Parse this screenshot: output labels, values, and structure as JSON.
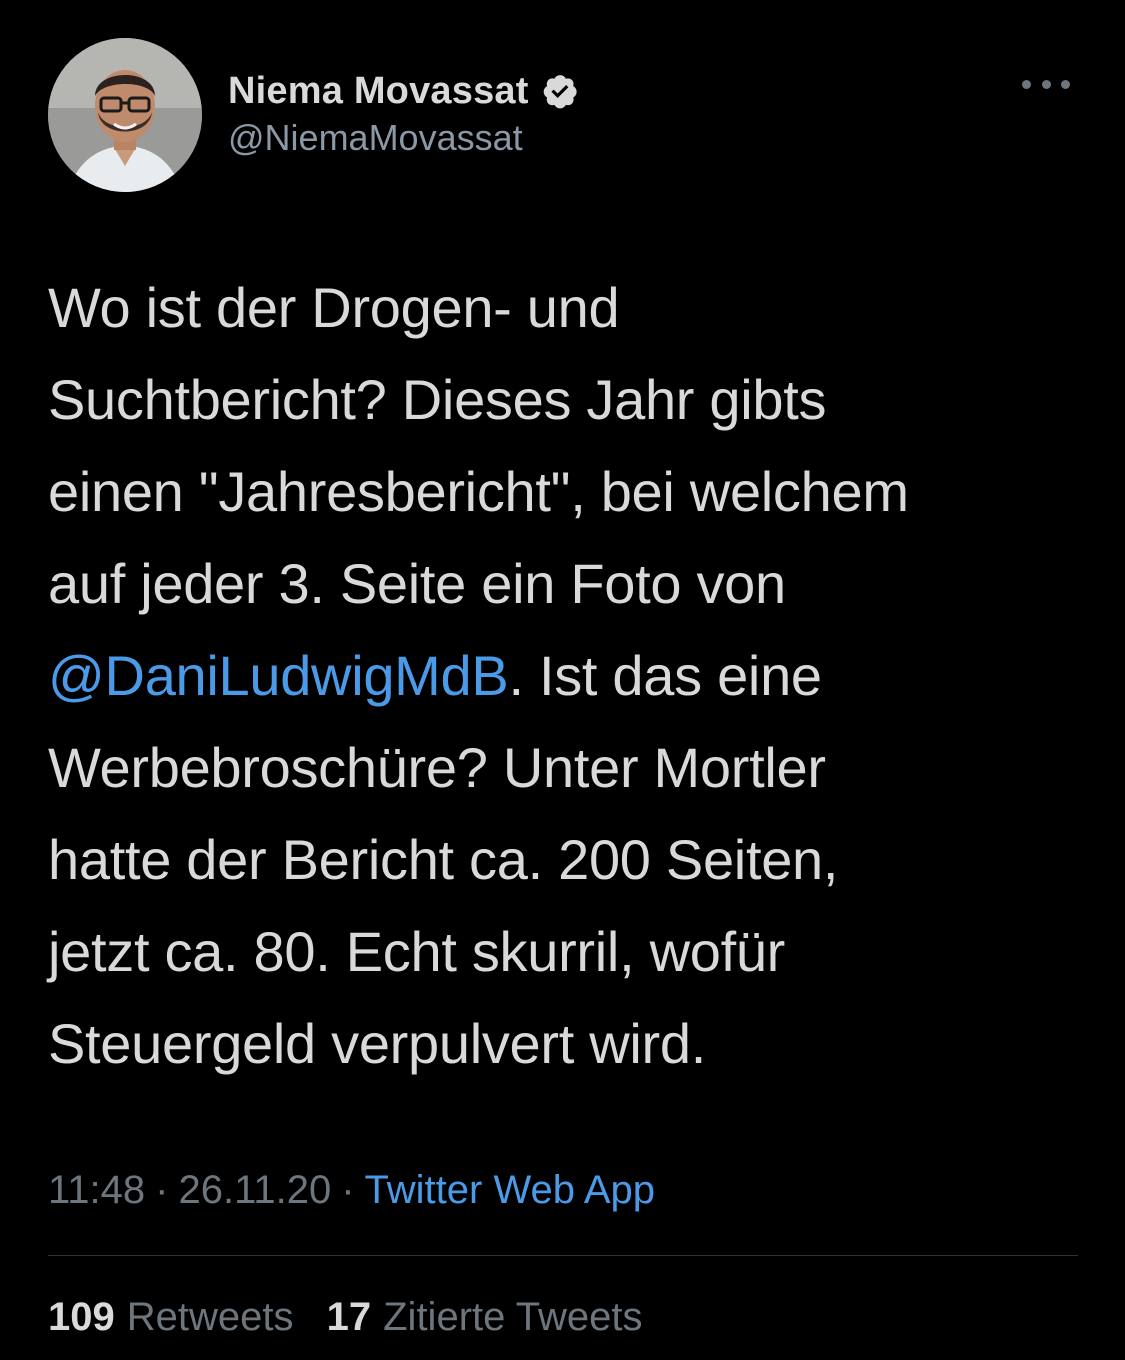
{
  "author": {
    "display_name": "Niema Movassat",
    "handle": "@NiemaMovassat",
    "verified": true,
    "avatar_icon": "profile-photo"
  },
  "more_icon": "more-horizontal-icon",
  "tweet": {
    "lines": [
      [
        {
          "text": "Wo ist der Drogen- und"
        }
      ],
      [
        {
          "text": "Suchtbericht? Dieses Jahr gibts"
        }
      ],
      [
        {
          "text": "einen \"Jahresbericht\", bei welchem"
        }
      ],
      [
        {
          "text": "auf jeder 3. Seite ein Foto von"
        }
      ],
      [
        {
          "text": "@DaniLudwigMdB",
          "mention": true
        },
        {
          "text": ". Ist das eine"
        }
      ],
      [
        {
          "text": "Werbebroschüre? Unter Mortler"
        }
      ],
      [
        {
          "text": "hatte der Bericht ca. 200 Seiten,"
        }
      ],
      [
        {
          "text": "jetzt ca. 80. Echt skurril, wofür"
        }
      ],
      [
        {
          "text": "Steuergeld verpulvert wird."
        }
      ]
    ]
  },
  "meta": {
    "time": "11:48",
    "separator": "·",
    "date": "26.11.20",
    "source": "Twitter Web App"
  },
  "stats": {
    "retweets_count": "109",
    "retweets_label": "Retweets",
    "quotes_count": "17",
    "quotes_label": "Zitierte Tweets"
  },
  "colors": {
    "background": "#000000",
    "text": "#d9d9d9",
    "secondary": "#6e767d",
    "link": "#4a9ae8"
  }
}
